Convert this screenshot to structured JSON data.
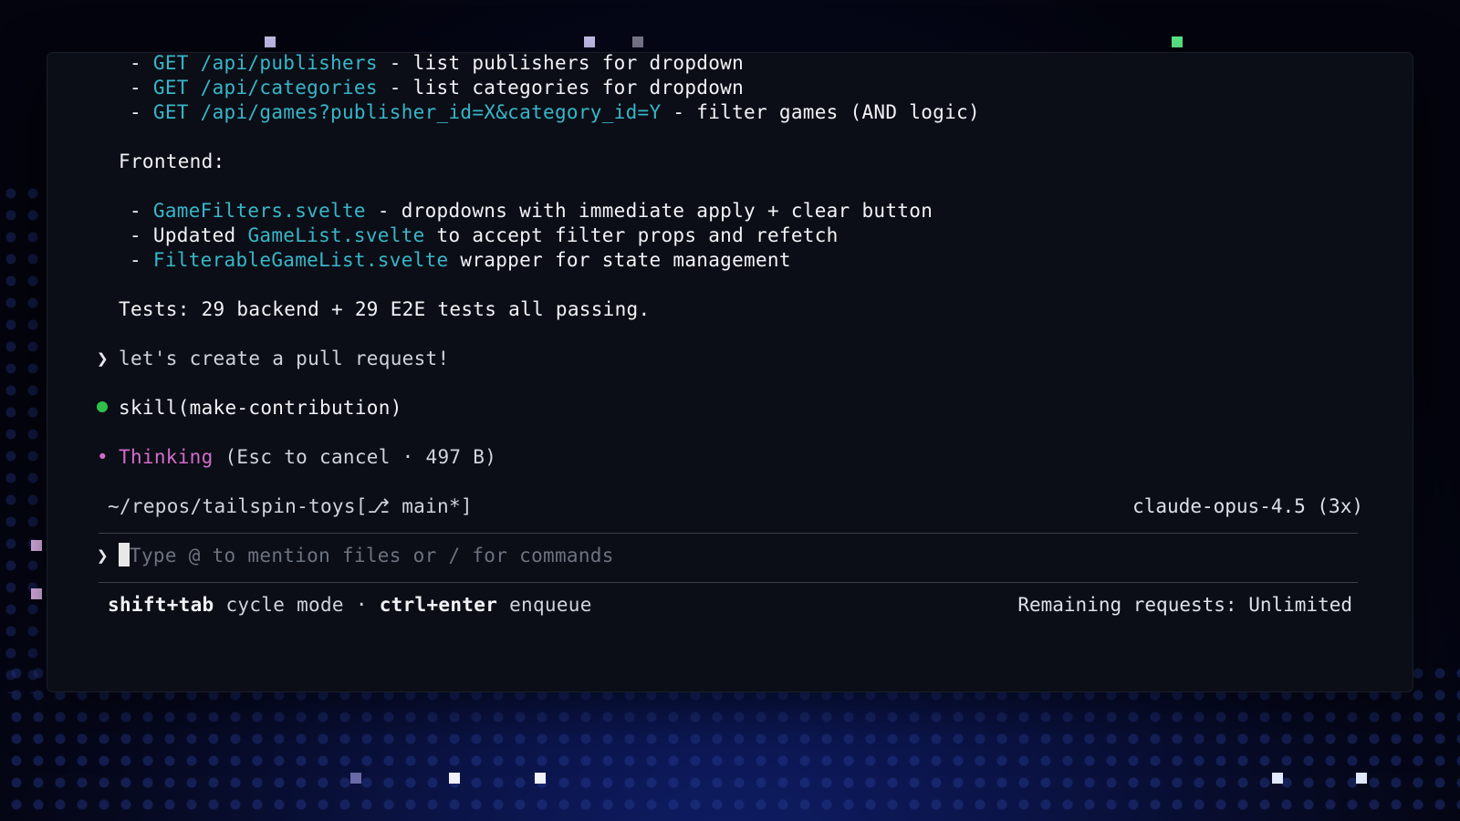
{
  "backend_endpoints": [
    {
      "code": "GET /api/publishers",
      "desc": " - list publishers for dropdown"
    },
    {
      "code": "GET /api/categories",
      "desc": " - list categories for dropdown"
    },
    {
      "code": "GET /api/games?publisher_id=X&category_id=Y",
      "desc": " - filter games (AND logic)"
    }
  ],
  "frontend_heading": "Frontend:",
  "frontend_items": [
    {
      "pre": "",
      "code": "GameFilters.svelte",
      "post": " - dropdowns with immediate apply + clear button"
    },
    {
      "pre": "Updated ",
      "code": "GameList.svelte",
      "post": " to accept filter props and refetch"
    },
    {
      "pre": "",
      "code": "FilterableGameList.svelte",
      "post": " wrapper for state management"
    }
  ],
  "tests_summary": "Tests: 29 backend + 29 E2E tests all passing.",
  "user_prompt": "let's create a pull request!",
  "skill_call": "skill(make-contribution)",
  "thinking": {
    "label": "Thinking",
    "detail": " (Esc to cancel · 497 B)"
  },
  "status_bar": {
    "path": "~/repos/tailspin-toys[⎇ main*]",
    "model": "claude-opus-4.5 (3x)"
  },
  "input": {
    "placeholder": "Type @ to mention files or / for commands"
  },
  "footer": {
    "shortcut1_key": "shift+tab",
    "shortcut1_desc": " cycle mode · ",
    "shortcut2_key": "ctrl+enter",
    "shortcut2_desc": " enqueue",
    "remaining": "Remaining requests: Unlimited"
  },
  "colors": {
    "link": "#38b6c9",
    "thinking": "#d46bc9",
    "success": "#2ec04a"
  }
}
